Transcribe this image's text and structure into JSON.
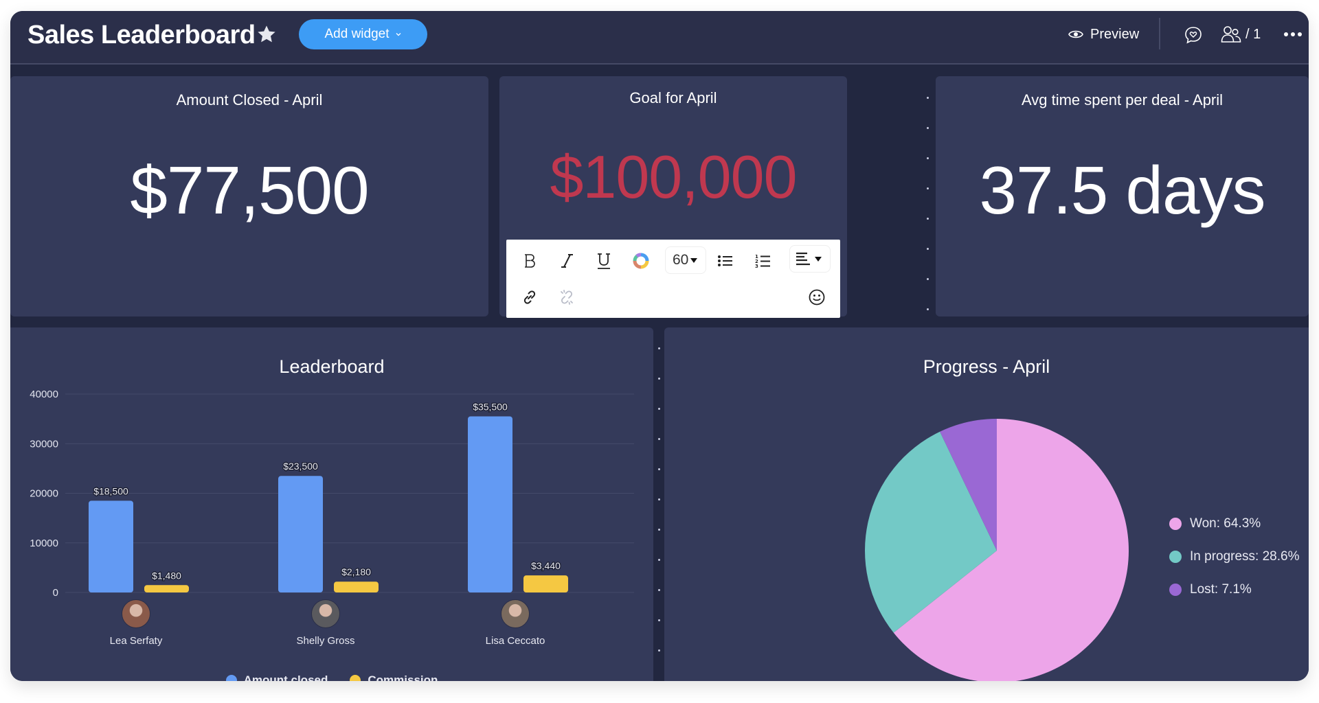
{
  "header": {
    "title": "Sales Leaderboard",
    "add_widget_label": "Add widget",
    "preview_label": "Preview",
    "members_count": "/ 1"
  },
  "cards": {
    "amount_closed": {
      "title": "Amount Closed - April",
      "value": "$77,500"
    },
    "goal": {
      "title": "Goal for April",
      "value": "$100,000",
      "value_color": "#c0384f"
    },
    "avg_time": {
      "title": "Avg time spent per deal - April",
      "value": "37.5 days"
    }
  },
  "text_toolbar": {
    "font_size": "60",
    "buttons": [
      "bold",
      "italic",
      "underline",
      "text-color",
      "font-size",
      "bulleted-list",
      "numbered-list",
      "align",
      "link",
      "unlink",
      "emoji"
    ]
  },
  "leaderboard": {
    "title": "Leaderboard",
    "people": [
      {
        "name": "Lea Serfaty",
        "avatar_color": "#8a5a4a"
      },
      {
        "name": "Shelly Gross",
        "avatar_color": "#5a5a5e"
      },
      {
        "name": "Lisa Ceccato",
        "avatar_color": "#7a6a5e"
      }
    ],
    "legend": [
      {
        "label": "Amount closed",
        "color": "#639af3"
      },
      {
        "label": "Commission",
        "color": "#f5c842"
      }
    ]
  },
  "progress": {
    "title": "Progress - April",
    "legend": [
      {
        "label": "Won: 64.3%",
        "color": "#eda5e9"
      },
      {
        "label": "In progress: 28.6%",
        "color": "#73c9c6"
      },
      {
        "label": "Lost: 7.1%",
        "color": "#9a68d4"
      }
    ]
  },
  "chart_data": [
    {
      "type": "bar",
      "title": "Leaderboard",
      "categories": [
        "Lea Serfaty",
        "Shelly Gross",
        "Lisa Ceccato"
      ],
      "series": [
        {
          "name": "Amount closed",
          "values": [
            18500,
            23500,
            35500
          ],
          "labels": [
            "$18,500",
            "$23,500",
            "$35,500"
          ],
          "color": "#639af3"
        },
        {
          "name": "Commission",
          "values": [
            1480,
            2180,
            3440
          ],
          "labels": [
            "$1,480",
            "$2,180",
            "$3,440"
          ],
          "color": "#f5c842"
        }
      ],
      "yticks": [
        0,
        10000,
        20000,
        30000,
        40000
      ],
      "ylim": [
        0,
        40000
      ],
      "xlabel": "",
      "ylabel": "",
      "grid": true,
      "legend": "bottom-center"
    },
    {
      "type": "pie",
      "title": "Progress - April",
      "slices": [
        {
          "label": "Won",
          "value": 64.3,
          "color": "#eda5e9"
        },
        {
          "label": "In progress",
          "value": 28.6,
          "color": "#73c9c6"
        },
        {
          "label": "Lost",
          "value": 7.1,
          "color": "#9a68d4"
        }
      ],
      "legend": "right"
    }
  ]
}
